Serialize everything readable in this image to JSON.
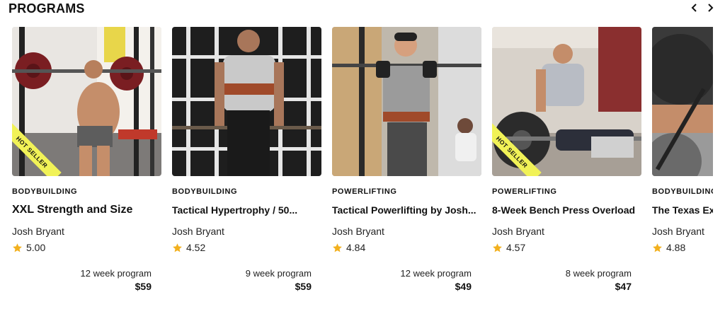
{
  "section": {
    "title": "PROGRAMS"
  },
  "nav": {
    "prev_icon": "chevron-left-icon",
    "next_icon": "chevron-right-icon"
  },
  "colors": {
    "ribbon": "#f1f257",
    "star": "#f2b01e"
  },
  "programs": [
    {
      "category": "BODYBUILDING",
      "name": "XXL Strength and Size",
      "author": "Josh Bryant",
      "rating": "5.00",
      "duration": "12 week program",
      "price": "$59",
      "badge": "HOT SELLER"
    },
    {
      "category": "BODYBUILDING",
      "name": "Tactical Hypertrophy / 50...",
      "author": "Josh Bryant",
      "rating": "4.52",
      "duration": "9 week program",
      "price": "$59"
    },
    {
      "category": "POWERLIFTING",
      "name": "Tactical Powerlifting by Josh...",
      "author": "Josh Bryant",
      "rating": "4.84",
      "duration": "12 week program",
      "price": "$49"
    },
    {
      "category": "POWERLIFTING",
      "name": "8-Week Bench Press Overload",
      "author": "Josh Bryant",
      "rating": "4.57",
      "duration": "8 week program",
      "price": "$47",
      "badge": "HOT SELLER"
    },
    {
      "category": "BODYBUILDING",
      "name": "The Texas Ext",
      "author": "Josh Bryant",
      "rating": "4.88"
    }
  ]
}
